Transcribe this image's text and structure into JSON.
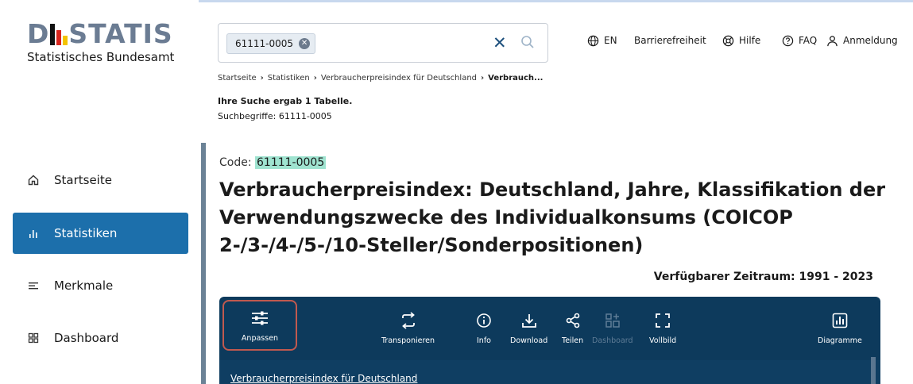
{
  "logo": {
    "word_left": "D",
    "word_right": "STATIS",
    "subtitle": "Statistisches Bundesamt",
    "flag_colors": [
      "#111111",
      "#d9251d",
      "#f3c300"
    ]
  },
  "sidebar": {
    "items": [
      {
        "label": "Startseite",
        "icon": "home-icon",
        "active": false
      },
      {
        "label": "Statistiken",
        "icon": "bar-chart-icon",
        "active": true
      },
      {
        "label": "Merkmale",
        "icon": "lines-icon",
        "active": false
      },
      {
        "label": "Dashboard",
        "icon": "grid-icon",
        "active": false
      }
    ]
  },
  "search": {
    "chip_label": "61111-0005",
    "placeholder": ""
  },
  "topnav": {
    "language": "EN",
    "accessibility": "Barrierefreiheit",
    "help": "Hilfe",
    "faq": "FAQ",
    "login": "Anmeldung"
  },
  "breadcrumb": {
    "items": [
      "Startseite",
      "Statistiken",
      "Verbraucherpreisindex für Deutschland"
    ],
    "current": "Verbrauch..."
  },
  "results": {
    "summary": "Ihre Suche ergab 1 Tabelle.",
    "terms": "Suchbegriffe: 61111-0005"
  },
  "main": {
    "code_label": "Code: ",
    "code_value": "61111-0005",
    "title": "Verbraucherpreisindex: Deutschland, Jahre, Klassifikation der Verwendungszwecke des Individualkonsums (COICOP 2-/3-/4-/5-/10-Steller/Sonderpositionen)",
    "period": "Verfügbarer Zeitraum: 1991 - 2023"
  },
  "toolbar": {
    "anpassen": "Anpassen",
    "transponieren": "Transponieren",
    "info": "Info",
    "download": "Download",
    "teilen": "Teilen",
    "dashboard": "Dashboard",
    "vollbild": "Vollbild",
    "diagramme": "Diagramme"
  },
  "table": {
    "link": "Verbraucherpreisindex für Deutschland"
  },
  "colors": {
    "accent": "#1c6fab",
    "toolbar_bg": "#0d3a5c",
    "highlight": "#9fe3d0",
    "focus_border": "#c0594f"
  }
}
